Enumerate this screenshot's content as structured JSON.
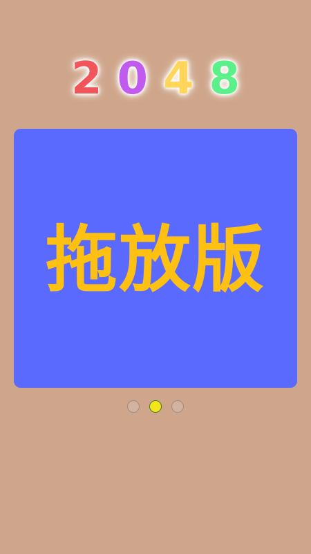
{
  "logo": {
    "chars": [
      {
        "text": "2",
        "color": "#f0555a"
      },
      {
        "text": "0",
        "color": "#c15bf0"
      },
      {
        "text": "4",
        "color": "#ffd65a"
      },
      {
        "text": "8",
        "color": "#5cf08a"
      }
    ]
  },
  "card": {
    "label": "拖放版",
    "background": "#5a6afe",
    "text_color": "#fdc013"
  },
  "pager": {
    "count": 3,
    "active_index": 1,
    "active_color": "#f4e51a",
    "inactive_color": "#d3b3a0"
  },
  "background": "#cfa68b"
}
